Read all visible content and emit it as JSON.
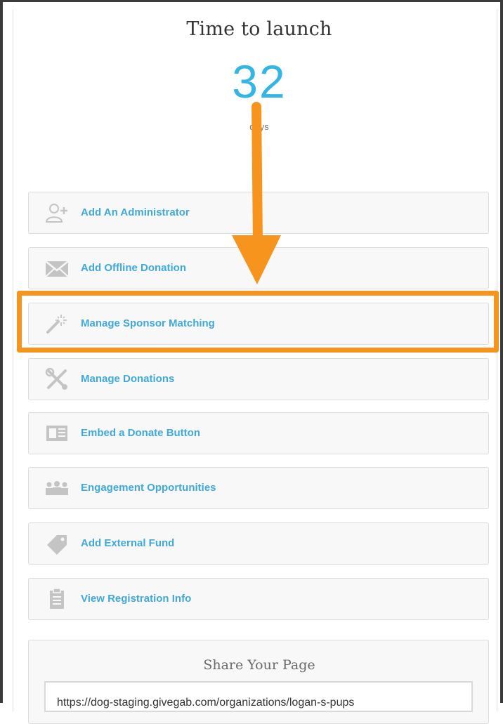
{
  "countdown": {
    "title": "Time to launch",
    "value": "32",
    "unit": "days"
  },
  "actions": [
    {
      "label": "Add An Administrator",
      "icon": "add-user-icon"
    },
    {
      "label": "Add Offline Donation",
      "icon": "envelope-icon"
    },
    {
      "label": "Manage Sponsor Matching",
      "icon": "magic-wand-icon"
    },
    {
      "label": "Manage Donations",
      "icon": "tools-icon"
    },
    {
      "label": "Embed a Donate Button",
      "icon": "embed-icon"
    },
    {
      "label": "Engagement Opportunities",
      "icon": "group-icon"
    },
    {
      "label": "Add External Fund",
      "icon": "tag-icon"
    },
    {
      "label": "View Registration Info",
      "icon": "clipboard-icon"
    }
  ],
  "share": {
    "title": "Share Your Page",
    "url": "https://dog-staging.givegab.com/organizations/logan-s-pups"
  },
  "annotation": {
    "highlighted_action": "Manage Sponsor Matching",
    "color": "#f7941d"
  },
  "colors": {
    "accent": "#33b5e5",
    "link": "#3fa9d8",
    "icon": "#c4c4c4"
  }
}
